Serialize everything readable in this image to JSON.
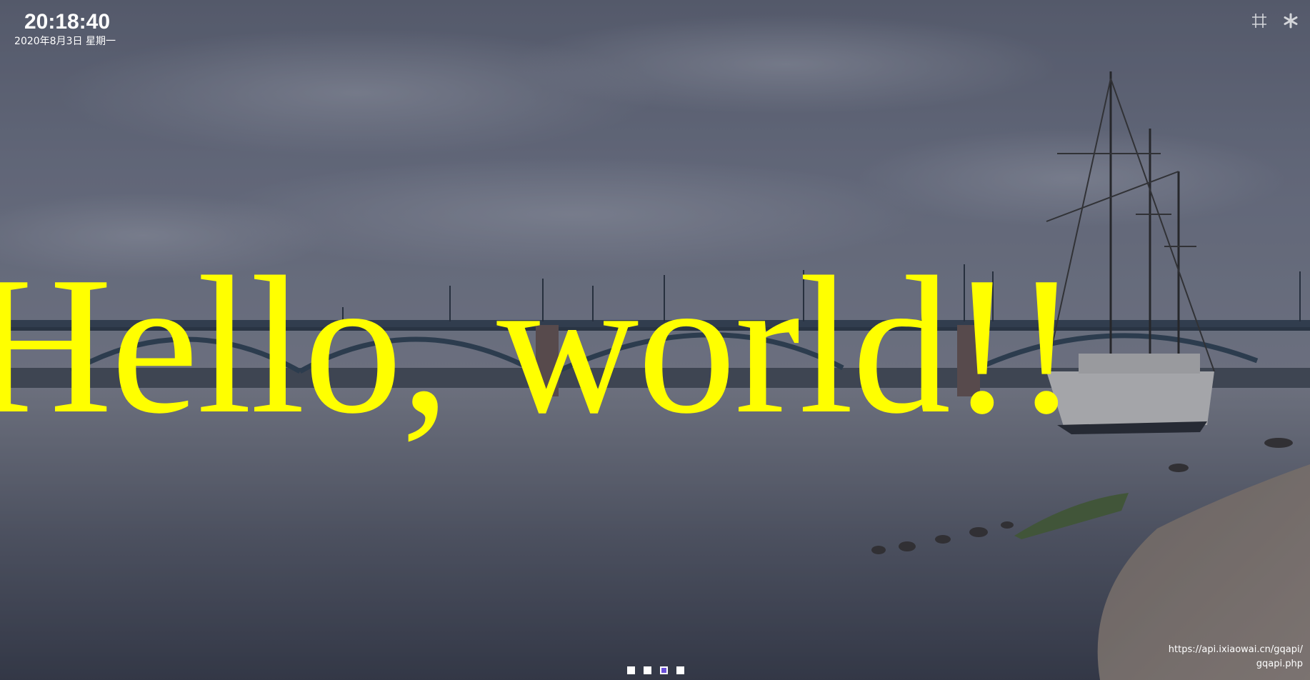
{
  "clock": {
    "time": "20:18:40",
    "date": "2020年8月3日 星期一"
  },
  "toolbar": {
    "icons": [
      "crop-icon",
      "settings-icon"
    ]
  },
  "greeting": {
    "text": "Hello, world!!"
  },
  "source": {
    "url": "https://api.ixiaowai.cn/gqapi/gqapi.php"
  },
  "pager": {
    "count": 4,
    "active_index": 2
  },
  "colors": {
    "greeting": "#ffff00",
    "active_dot": "#6a4fd8",
    "overlay_text": "#ffffff"
  }
}
